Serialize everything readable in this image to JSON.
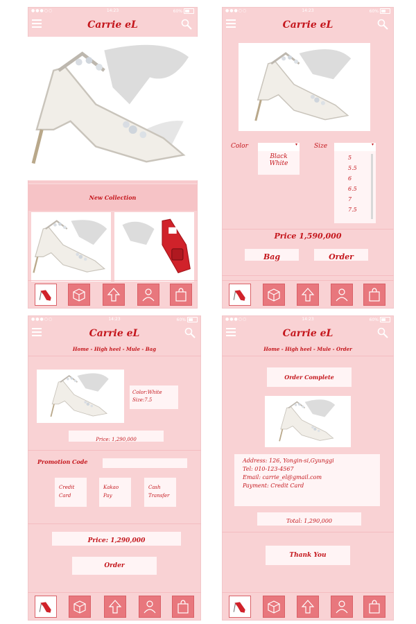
{
  "app": {
    "brand": "Carrie eL",
    "status_time": "14:23",
    "status_battery": "60%"
  },
  "screen1": {
    "banner": "New Collection"
  },
  "screen2": {
    "color_label": "Color",
    "size_label": "Size",
    "color_options": [
      "Black",
      "White"
    ],
    "sizes": [
      "5",
      "5.5",
      "6",
      "6.5",
      "7",
      "7.5"
    ],
    "price": "Price 1,590,000",
    "bag_button": "Bag",
    "order_button": "Order"
  },
  "screen3": {
    "breadcrumb": "Home - High heel - Mule - Bag",
    "item_color": "Color:White",
    "item_size": "Size:7.5",
    "item_price": "Price: 1,290,000",
    "promo_label": "Promotion Code",
    "promo_value": "",
    "pay_credit": "Credit Card",
    "pay_kakao": "Kakao Pay",
    "pay_cash": "Cash Transfer",
    "total_price": "Price: 1,290,000",
    "order_button": "Order"
  },
  "screen4": {
    "breadcrumb": "Home - High heel - Mule - Order",
    "status": "Order Complete",
    "address": "Address: 126, Yongin-si,Gyunggi",
    "tel": "Tel: 010-123-4567",
    "email": "Email: carrie_el@gmail.com",
    "payment": "Payment: Credit Card",
    "total": "Total: 1,290,000",
    "thanks": "Thank You"
  },
  "icons": [
    "menu-icon",
    "search-icon",
    "shoe-thumbnail",
    "box-icon",
    "up-arrow-icon",
    "person-icon",
    "bag-icon"
  ],
  "colors": {
    "background": "#f9d2d4",
    "accent": "#c4161c",
    "tab": "#e8777d",
    "panel": "#fff4f5"
  }
}
